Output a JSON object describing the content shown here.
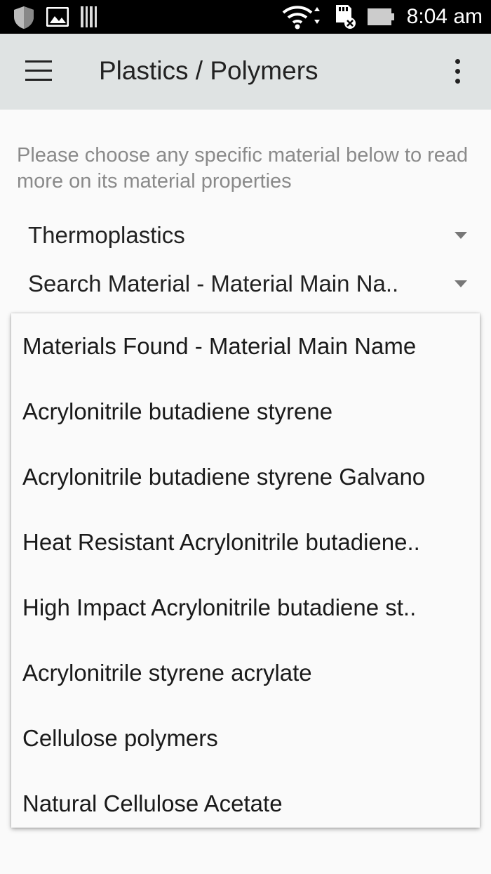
{
  "status_bar": {
    "time": "8:04 am",
    "icons": [
      "shield-icon",
      "image-icon",
      "barcode-icon",
      "wifi-icon",
      "sd-card-icon",
      "battery-icon"
    ]
  },
  "app_bar": {
    "title": "Plastics / Polymers",
    "menu_icon": "hamburger-menu-icon",
    "overflow_icon": "more-vertical-icon"
  },
  "intro_text": "Please choose any specific material below to read more on its material properties",
  "category_spinner": {
    "selected": "Thermoplastics"
  },
  "search_spinner": {
    "selected": "Search Material - Material Main Na.."
  },
  "dropdown": {
    "items": [
      "Materials Found - Material Main Name",
      "Acrylonitrile butadiene styrene",
      "Acrylonitrile butadiene styrene Galvano",
      "Heat Resistant Acrylonitrile butadiene..",
      "High Impact Acrylonitrile butadiene st..",
      "Acrylonitrile styrene acrylate",
      "Cellulose polymers",
      "Natural Cellulose Acetate"
    ]
  },
  "colors": {
    "status_bar": "#000000",
    "app_bar": "#dfe3e3",
    "background": "#fafafa",
    "intro_text": "#8a8a8a"
  }
}
